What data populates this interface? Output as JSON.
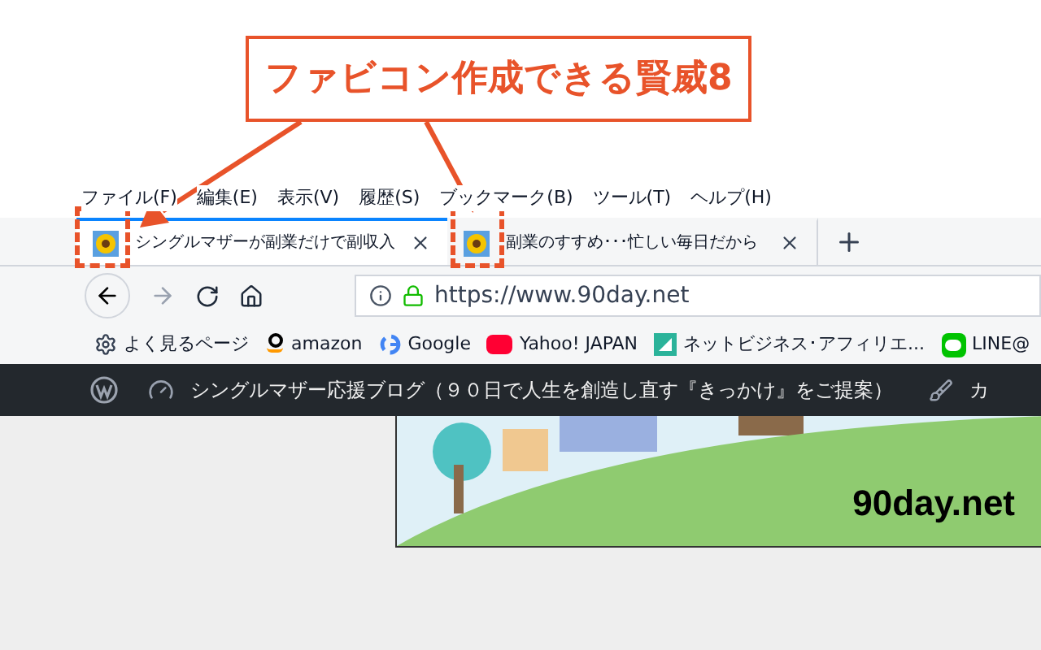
{
  "callout": {
    "text": "ファビコン作成できる賢威8"
  },
  "menu": [
    "ファイル(F)",
    "編集(E)",
    "表示(V)",
    "履歴(S)",
    "ブックマーク(B)",
    "ツール(T)",
    "ヘルプ(H)"
  ],
  "tabs": [
    {
      "title": "シングルマザーが副業だけで副収入",
      "selected": true,
      "highlighted": true
    },
    {
      "title": "副業のすすめ･･･忙しい毎日だから",
      "selected": false,
      "highlighted": true
    }
  ],
  "address": {
    "url": "https://www.90day.net"
  },
  "bookmarks": [
    {
      "label": "よく見るページ",
      "kind": "gear"
    },
    {
      "label": "amazon",
      "kind": "amazon"
    },
    {
      "label": "Google",
      "kind": "google"
    },
    {
      "label": "Yahoo! JAPAN",
      "kind": "yahoo"
    },
    {
      "label": "ネットビジネス･アフィリエ...",
      "kind": "site"
    },
    {
      "label": "LINE@",
      "kind": "line"
    }
  ],
  "admin_bar": {
    "site_title": "シングルマザー応援ブログ（９０日で人生を創造し直す『きっかけ』をご提案）",
    "next_item": "カ"
  },
  "banner": {
    "text": "90day.net"
  }
}
